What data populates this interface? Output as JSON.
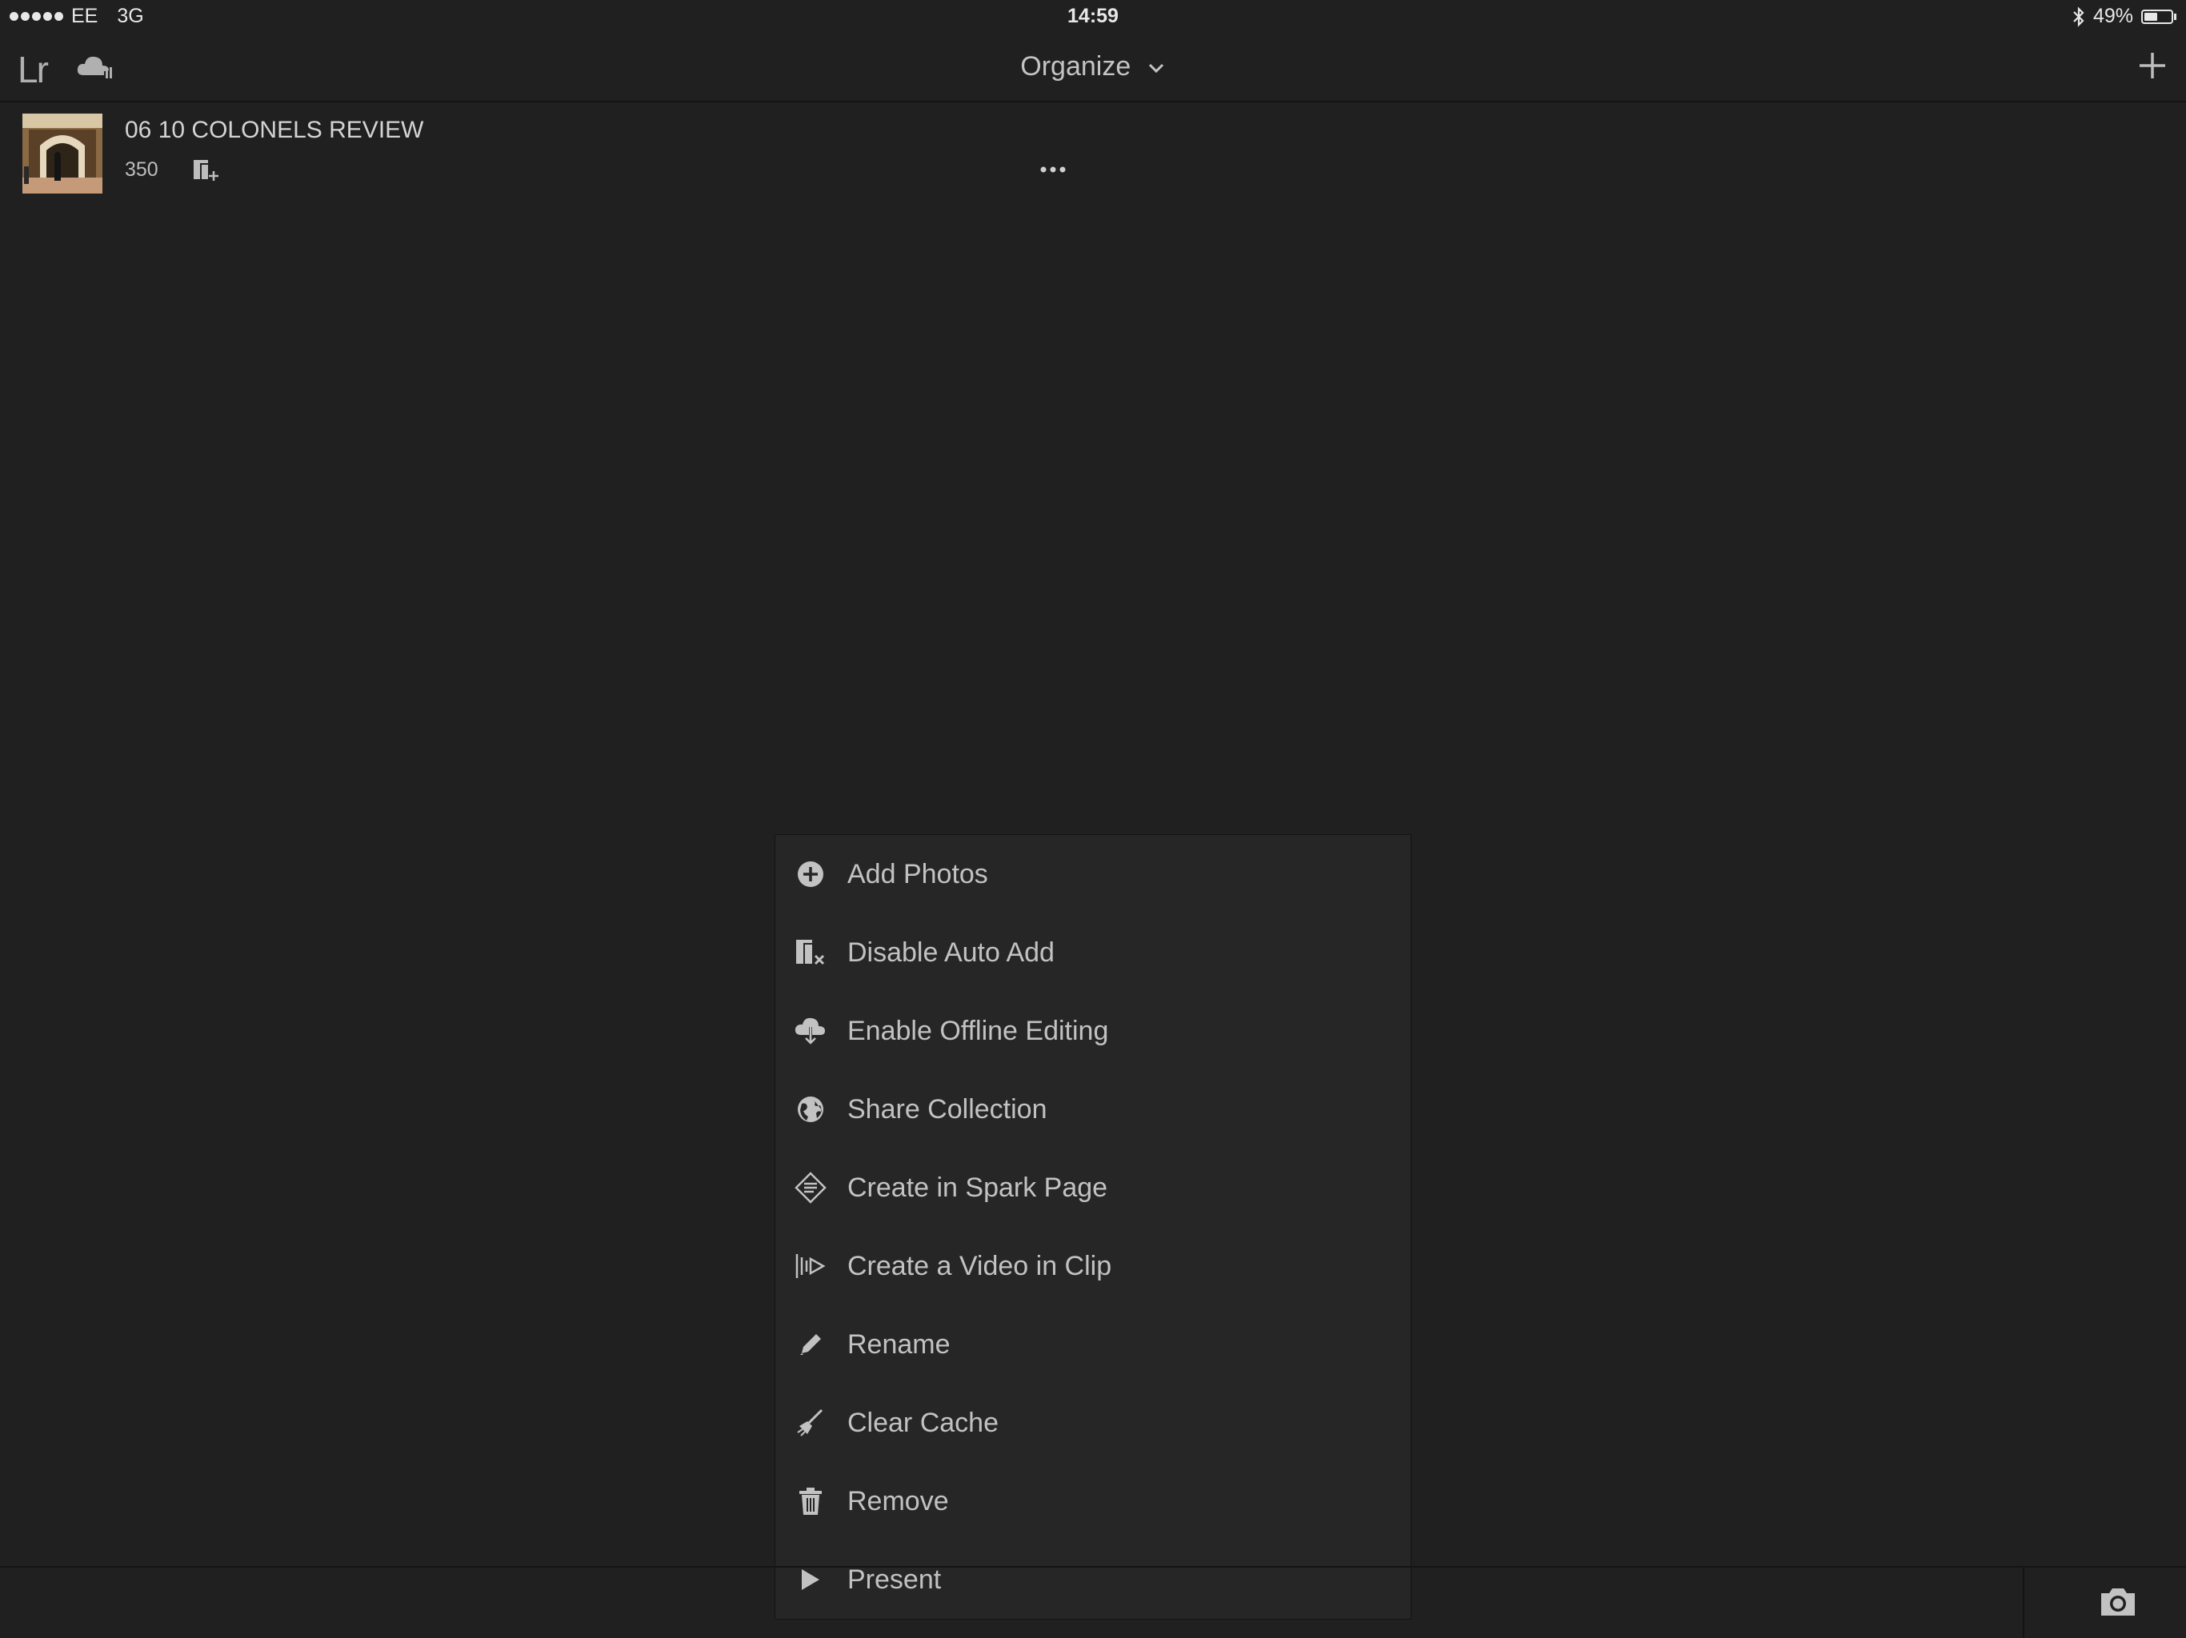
{
  "status_bar": {
    "carrier": "EE",
    "network": "3G",
    "time": "14:59",
    "battery": "49%",
    "battery_level": 0.49
  },
  "top_bar": {
    "logo": "Lr",
    "view_title": "Organize",
    "icons": {
      "cloud": "cloud-sync-icon",
      "add": "plus-icon",
      "chevron": "chevron-down-icon"
    }
  },
  "collection": {
    "name": "06 10 COLONELS REVIEW",
    "count": "350"
  },
  "menu": {
    "items": [
      {
        "label": "Add Photos",
        "icon": "add-circle-icon"
      },
      {
        "label": "Disable Auto Add",
        "icon": "disable-auto-add-icon"
      },
      {
        "label": "Enable Offline Editing",
        "icon": "cloud-download-icon"
      },
      {
        "label": "Share Collection",
        "icon": "globe-icon"
      },
      {
        "label": "Create in Spark Page",
        "icon": "spark-page-icon"
      },
      {
        "label": "Create a Video in Clip",
        "icon": "clip-video-icon"
      },
      {
        "label": "Rename",
        "icon": "pencil-icon"
      },
      {
        "label": "Clear Cache",
        "icon": "broom-icon"
      },
      {
        "label": "Remove",
        "icon": "trash-icon"
      },
      {
        "label": "Present",
        "icon": "play-icon"
      }
    ]
  },
  "bottom_bar": {
    "camera": "camera-icon"
  },
  "colors": {
    "background": "#202020",
    "menu_bg": "#262626",
    "text": "#c2c2c2"
  }
}
